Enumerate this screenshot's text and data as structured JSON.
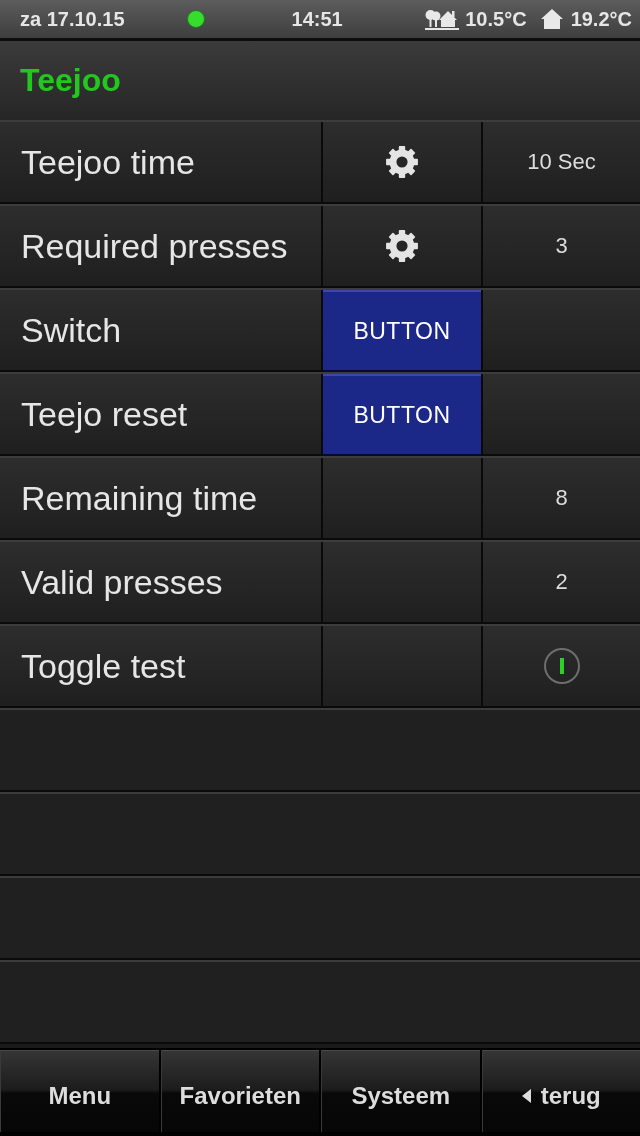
{
  "status_bar": {
    "date": "za 17.10.15",
    "connected": true,
    "time": "14:51",
    "temperatures": [
      {
        "kind": "outdoor",
        "value": "10.5°C"
      },
      {
        "kind": "indoor",
        "value": "19.2°C"
      }
    ]
  },
  "header": {
    "title": "Teejoo"
  },
  "rows": [
    {
      "kind": "setting",
      "label": "Teejoo time",
      "value": "10 Sec"
    },
    {
      "kind": "setting",
      "label": "Required presses",
      "value": "3"
    },
    {
      "kind": "button",
      "label": "Switch",
      "button": "BUTTON"
    },
    {
      "kind": "button",
      "label": "Teejo reset",
      "button": "BUTTON"
    },
    {
      "kind": "value",
      "label": "Remaining time",
      "value": "8"
    },
    {
      "kind": "value",
      "label": "Valid presses",
      "value": "2"
    },
    {
      "kind": "toggle",
      "label": "Toggle test",
      "on": true
    }
  ],
  "tab_bar": {
    "tabs": [
      {
        "kind": "link",
        "label": "Menu"
      },
      {
        "kind": "link",
        "label": "Favorieten"
      },
      {
        "kind": "link",
        "label": "Systeem"
      },
      {
        "kind": "back",
        "label": "terug"
      }
    ]
  }
}
